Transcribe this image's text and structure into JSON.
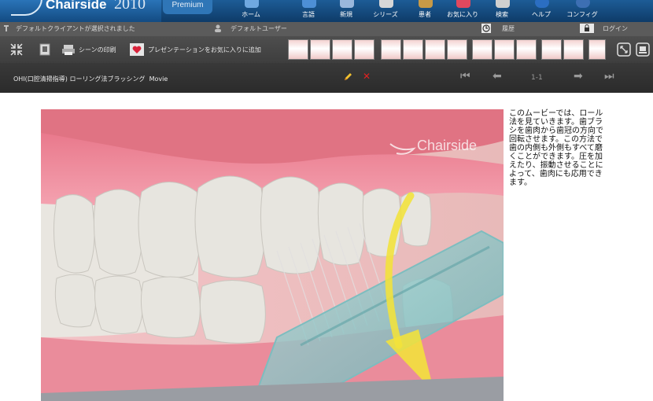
{
  "app": {
    "logo": "Chairside",
    "year": "2010",
    "edition": "Premium"
  },
  "nav": [
    {
      "label": "ホーム",
      "icon": "home-icon"
    },
    {
      "label": "言語",
      "icon": "language-icon"
    },
    {
      "label": "新規",
      "icon": "new-icon"
    },
    {
      "label": "シリーズ",
      "icon": "series-icon"
    },
    {
      "label": "患者",
      "icon": "patient-icon"
    },
    {
      "label": "お気に入り",
      "icon": "favorite-icon"
    },
    {
      "label": "検索",
      "icon": "search-icon"
    },
    {
      "label": "ヘルプ",
      "icon": "help-icon"
    },
    {
      "label": "コンフィグ",
      "icon": "config-icon"
    }
  ],
  "status": {
    "client": "デフォルトクライアントが選択されました",
    "user": "デフォルトユーザー",
    "history": "履歴",
    "login": "ログイン"
  },
  "toolbar": {
    "print_scene": "シーンの印刷",
    "add_presentation": "プレゼンテーションをお気に入りに追加"
  },
  "scene": {
    "title": "OHI(口腔清掃指導) ローリング法ブラッシング",
    "type": "Movie",
    "page": "1-1",
    "watermark": "Chairside",
    "description": "このムービーでは、ロール法を見ていきます。歯ブラシを歯肉から歯冠の方向で回転させます。この方法で歯の内側も外側もすべて磨くことができます。圧を加えたり、振動させることによって、歯肉にも応用できます。"
  },
  "colors": {
    "topbar": "#134b82",
    "statusbar": "#5b5b5b",
    "toolbar": "#4a4a4a",
    "titlebar": "#333333",
    "arrow": "#f2e33a",
    "gum": "#ef8e9e"
  }
}
